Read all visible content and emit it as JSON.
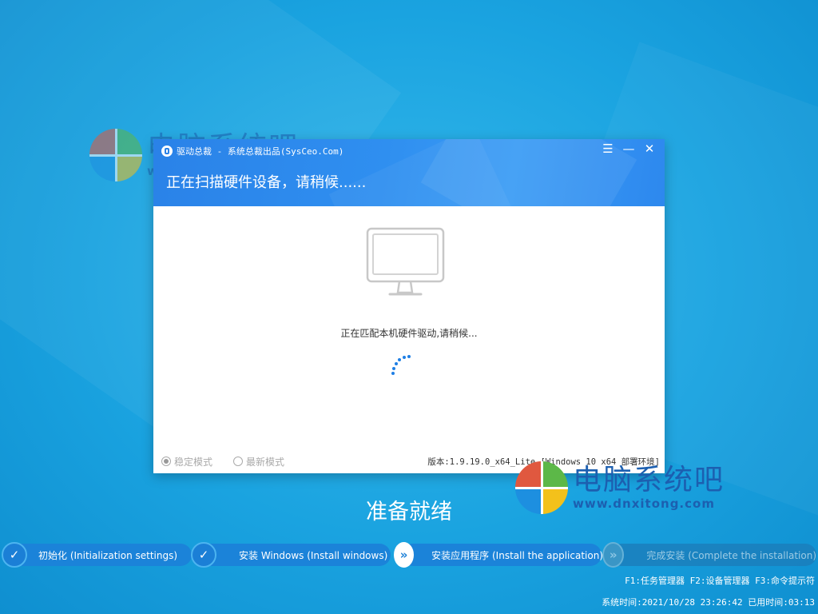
{
  "watermark": {
    "title": "电脑系统吧",
    "url": "www.dnxitong.com"
  },
  "window": {
    "title": "驱动总裁 - 系统总裁出品(SysCeo.Com)",
    "controls": {
      "menu": "☰",
      "minimize": "—",
      "close": "✕"
    },
    "heading": "正在扫描硬件设备，请稍候......",
    "status": "正在匹配本机硬件驱动,请稍候...",
    "modes": [
      {
        "label": "稳定模式",
        "selected": true
      },
      {
        "label": "最新模式",
        "selected": false
      }
    ],
    "version": "版本:1.9.19.0_x64_Lite [Windows 10 x64 部署环境]"
  },
  "ready": "准备就绪",
  "steps": [
    {
      "label": "初始化 (Initialization settings)",
      "state": "done",
      "icon": "check-icon"
    },
    {
      "label": "安装 Windows (Install windows)",
      "state": "done",
      "icon": "check-icon"
    },
    {
      "label": "安装应用程序 (Install the application)",
      "state": "current",
      "icon": "double-chevron-icon"
    },
    {
      "label": "完成安装 (Complete the installation)",
      "state": "pending",
      "icon": "double-chevron-icon"
    }
  ],
  "hotkeys": [
    "F1:任务管理器",
    "F2:设备管理器",
    "F3:命令提示符"
  ],
  "system_time": "系统时间:2021/10/28 23:26:42 已用时间:03:13",
  "colors": {
    "background": "#1aa3e0",
    "header_blue": "#2f8ff0",
    "step_blue": "#1b83d9",
    "spinner": "#1f7fe5"
  }
}
